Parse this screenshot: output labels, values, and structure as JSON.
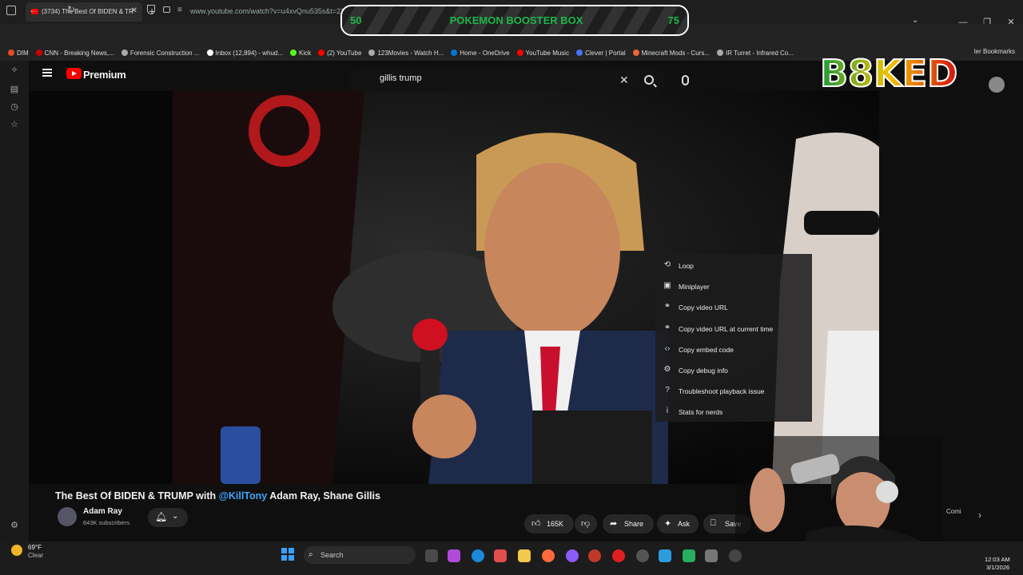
{
  "browser": {
    "tab_title": "(3734) The Best Of BIDEN & TR",
    "tab_close": "✕",
    "new_tab": "+",
    "url": "www.youtube.com/watch?v=u4xvQnu535s&t=2185",
    "other_bookmarks": "ler Bookmarks",
    "bookmarks": [
      {
        "label": "DIM",
        "color": "#e34c26"
      },
      {
        "label": "CNN - Breaking News,...",
        "color": "#cc0000"
      },
      {
        "label": "Forensic Construction ...",
        "color": "#aaaaaa"
      },
      {
        "label": "Inbox (12,894) - whud...",
        "color": "#ffffff"
      },
      {
        "label": "Kick",
        "color": "#53fc18"
      },
      {
        "label": "(2) YouTube",
        "color": "#ff0000"
      },
      {
        "label": "123Movies - Watch H...",
        "color": "#aaaaaa"
      },
      {
        "label": "Home - OneDrive",
        "color": "#0078d4"
      },
      {
        "label": "YouTube Music",
        "color": "#ff0000"
      },
      {
        "label": "Clever | Portal",
        "color": "#4274f6"
      },
      {
        "label": "Minecraft Mods - Curs...",
        "color": "#f16436"
      },
      {
        "label": "IR Turret - Infrared Co...",
        "color": "#aaaaaa"
      }
    ]
  },
  "youtube": {
    "brand": "Premium",
    "search_query": "gillis trump",
    "video_title": "The Best Of BIDEN & TRUMP with",
    "video_title_mention": "@KillTony",
    "video_title_rest": "Adam Ray, Shane Gillis",
    "channel_name": "Adam Ray",
    "channel_subs": "643K subscribers",
    "like_count": "165K",
    "share_label": "Share",
    "ask_label": "Ask",
    "save_label": "Save",
    "more_label": "...",
    "context_menu": [
      {
        "icon": "loop-icon",
        "glyph": "⟲",
        "label": "Loop"
      },
      {
        "icon": "miniplayer-icon",
        "glyph": "▣",
        "label": "Miniplayer"
      },
      {
        "icon": "link-icon",
        "glyph": "⚭",
        "label": "Copy video URL"
      },
      {
        "icon": "link-icon",
        "glyph": "⚭",
        "label": "Copy video URL at current time"
      },
      {
        "icon": "embed-icon",
        "glyph": "‹›",
        "label": "Copy embed code"
      },
      {
        "icon": "debug-icon",
        "glyph": "⚙",
        "label": "Copy debug info"
      },
      {
        "icon": "help-icon",
        "glyph": "?",
        "label": "Troubleshoot playback issue"
      },
      {
        "icon": "info-icon",
        "glyph": "i",
        "label": "Stats for nerds"
      }
    ],
    "side_chip": "Comi"
  },
  "overlay": {
    "pokemon_left": "50",
    "pokemon_title": "POKEMON BOOSTER BOX",
    "pokemon_right": "75",
    "logo_text": "B8KED"
  },
  "taskbar": {
    "temperature": "69°F",
    "condition": "Clear",
    "search_label": "Search",
    "time": "12:03 AM",
    "date": "3/1/2026"
  }
}
